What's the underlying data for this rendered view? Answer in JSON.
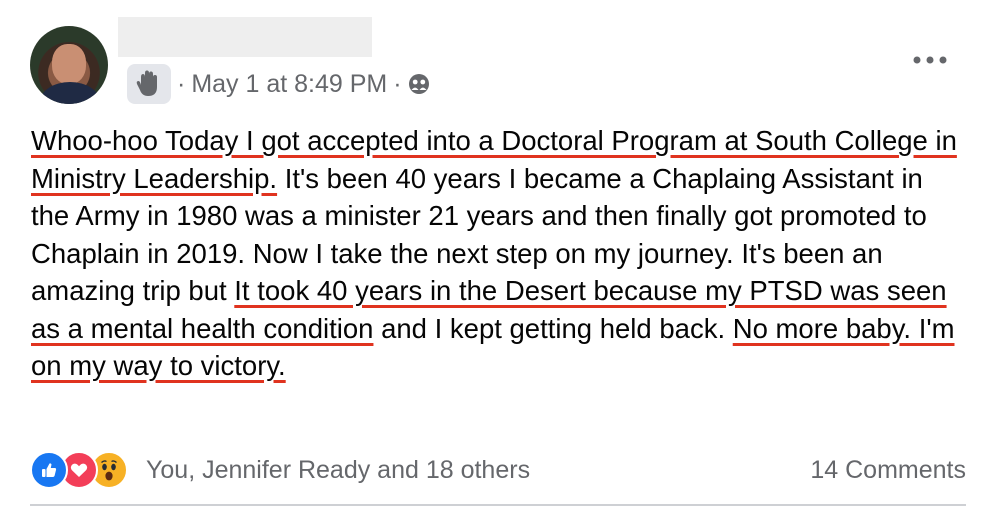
{
  "post": {
    "author_name": "",
    "timestamp": "May 1 at 8:49 PM",
    "audience_icon": "friends-icon",
    "status_icon": "wave-icon",
    "more_icon": "more-options-icon",
    "segments": [
      {
        "text": "Whoo-hoo Today I got accepted into a Doctoral Program at South College in Ministry Leadership.",
        "highlight": true
      },
      {
        "text": " It's been 40 years I became a Chaplaing Assistant in the Army in 1980 was a minister 21 years and then finally got promoted to Chaplain in 2019. Now I take the next step on my journey. It's been an amazing trip but ",
        "highlight": false
      },
      {
        "text": "It took 40 years in the Desert because my PTSD was seen as a mental health condition",
        "highlight": true
      },
      {
        "text": " and I kept getting held back. ",
        "highlight": false
      },
      {
        "text": "No more baby. I'm on my way to victory.",
        "highlight": true
      }
    ]
  },
  "reactions": {
    "icons": [
      "like-icon",
      "love-icon",
      "wow-icon"
    ],
    "reacted_by": "You, Jennifer Ready and 18 others",
    "comments": "14 Comments"
  },
  "colors": {
    "like": "#1877f2",
    "love": "#f33e58",
    "wow": "#f7b125",
    "highlight_underline": "#e0331f",
    "secondary_text": "#65676b"
  }
}
